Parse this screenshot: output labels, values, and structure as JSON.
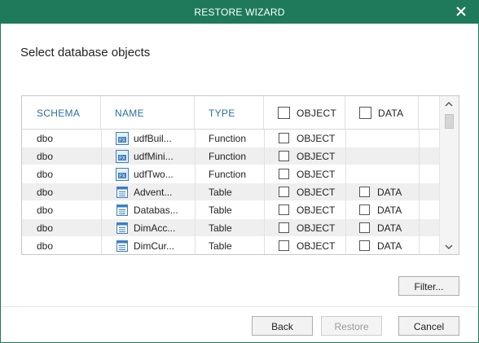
{
  "window": {
    "title": "RESTORE WIZARD"
  },
  "heading": "Select database objects",
  "grid": {
    "columns": {
      "schema": "SCHEMA",
      "name": "NAME",
      "type": "TYPE",
      "object": "OBJECT",
      "data": "DATA"
    },
    "rows": [
      {
        "schema": "dbo",
        "icon": "function-icon",
        "name": "udfBuil...",
        "type": "Function",
        "object_label": "OBJECT",
        "data_label": ""
      },
      {
        "schema": "dbo",
        "icon": "function-icon",
        "name": "udfMini...",
        "type": "Function",
        "object_label": "OBJECT",
        "data_label": ""
      },
      {
        "schema": "dbo",
        "icon": "function-icon",
        "name": "udfTwo...",
        "type": "Function",
        "object_label": "OBJECT",
        "data_label": ""
      },
      {
        "schema": "dbo",
        "icon": "table-icon",
        "name": "Advent...",
        "type": "Table",
        "object_label": "OBJECT",
        "data_label": "DATA"
      },
      {
        "schema": "dbo",
        "icon": "table-icon",
        "name": "Databas...",
        "type": "Table",
        "object_label": "OBJECT",
        "data_label": "DATA"
      },
      {
        "schema": "dbo",
        "icon": "table-icon",
        "name": "DimAcc...",
        "type": "Table",
        "object_label": "OBJECT",
        "data_label": "DATA"
      },
      {
        "schema": "dbo",
        "icon": "table-icon",
        "name": "DimCur...",
        "type": "Table",
        "object_label": "OBJECT",
        "data_label": "DATA"
      }
    ]
  },
  "buttons": {
    "filter": "Filter...",
    "back": "Back",
    "restore": "Restore",
    "cancel": "Cancel"
  },
  "colors": {
    "titlebar": "#1e7a5a",
    "header_text": "#2a6fa6"
  }
}
